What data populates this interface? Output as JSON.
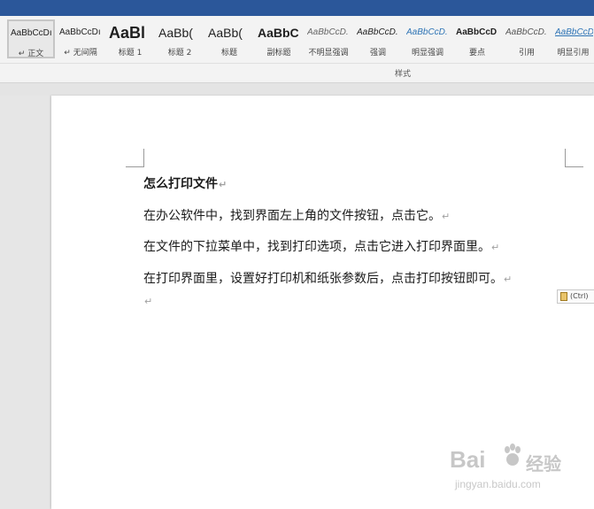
{
  "ribbon": {
    "group_label": "样式",
    "styles": [
      {
        "preview": "AaBbCcDı",
        "name": "↵ 正文",
        "selected": true
      },
      {
        "preview": "AaBbCcDı",
        "name": "↵ 无间隔"
      },
      {
        "preview": "AaBl",
        "name": "标题 1"
      },
      {
        "preview": "AaBb(",
        "name": "标题 2"
      },
      {
        "preview": "AaBb(",
        "name": "标题"
      },
      {
        "preview": "AaBbC",
        "name": "副标题"
      },
      {
        "preview": "AaBbCcD.",
        "name": "不明显强调"
      },
      {
        "preview": "AaBbCcD.",
        "name": "强调"
      },
      {
        "preview": "AaBbCcD.",
        "name": "明显强调"
      },
      {
        "preview": "AaBbCcD",
        "name": "要点"
      },
      {
        "preview": "AaBbCcD.",
        "name": "引用"
      },
      {
        "preview": "AaBbCcD",
        "name": "明显引用"
      }
    ]
  },
  "document": {
    "heading": "怎么打印文件",
    "paragraphs": [
      "在办公软件中，找到界面左上角的文件按钮，点击它。",
      "在文件的下拉菜单中，找到打印选项，点击它进入打印界面里。",
      "在打印界面里，设置好打印机和纸张参数后，点击打印按钮即可。"
    ],
    "paragraph_mark": "↵"
  },
  "paste_options": {
    "label": "(Ctrl)"
  },
  "watermark": {
    "main": "Bai",
    "cn": "经验",
    "url": "jingyan.baidu.com"
  }
}
